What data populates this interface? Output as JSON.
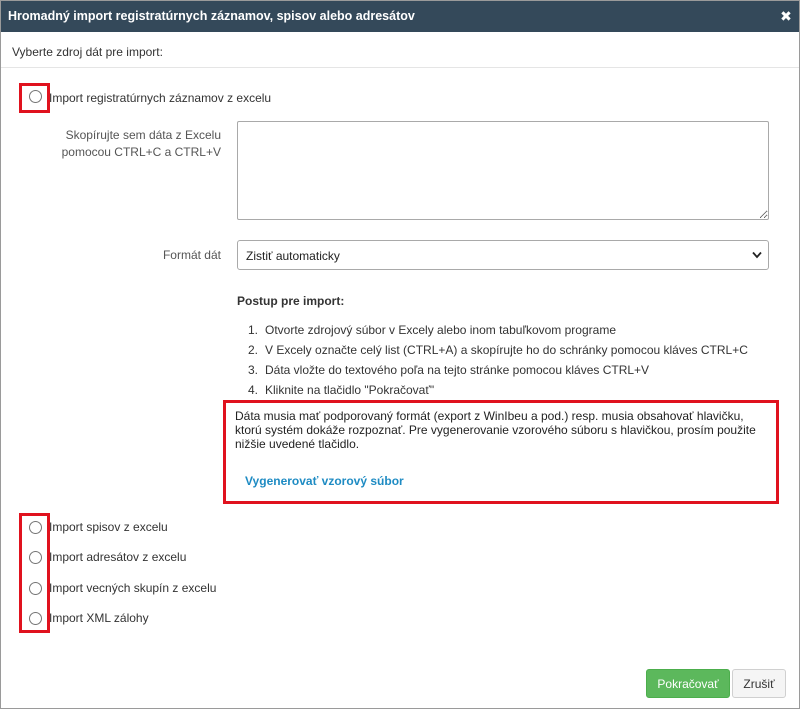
{
  "dialog": {
    "title": "Hromadný import registratúrnych záznamov, spisov alebo adresátov",
    "close_icon": "close-icon",
    "close_symbol": "✖",
    "subtitle": "Vyberte zdroj dát pre import:"
  },
  "options": [
    {
      "label": "Import registratúrnych záznamov z excelu",
      "selected": false
    },
    {
      "label": "Import spisov z excelu",
      "selected": false
    },
    {
      "label": "Import adresátov z excelu",
      "selected": false
    },
    {
      "label": "Import vecných skupín z excelu",
      "selected": false
    },
    {
      "label": "Import XML zálohy",
      "selected": false
    }
  ],
  "form": {
    "paste_label_line1": "Skopírujte sem dáta z Excelu",
    "paste_label_line2": "pomocou CTRL+C a CTRL+V",
    "paste_value": "",
    "format_label": "Formát dát",
    "format_selected": "Zistiť automaticky"
  },
  "instructions": {
    "title": "Postup pre import:",
    "steps": [
      {
        "num": "1.",
        "text": "Otvorte zdrojový súbor v Excely alebo inom tabuľkovom programe"
      },
      {
        "num": "2.",
        "text": "V Excely označte celý list (CTRL+A) a skopírujte ho do schránky pomocou kláves CTRL+C"
      },
      {
        "num": "3.",
        "text": "Dáta vložte do textového poľa na tejto stránke pomocou kláves CTRL+V"
      },
      {
        "num": "4.",
        "text": "Kliknite na tlačidlo \"Pokračovať\""
      }
    ]
  },
  "notice": {
    "text": "Dáta musia mať podporovaný formát (export z WinIbeu a pod.) resp. musia obsahovať hlavičku, ktorú systém dokáže rozpoznať. Pre vygenerovanie vzorového súboru s hlavičkou, prosím použite nižšie uvedené tlačidlo.",
    "link": "Vygenerovať vzorový súbor"
  },
  "footer": {
    "continue_label": "Pokračovať",
    "cancel_label": "Zrušiť"
  },
  "colors": {
    "titlebar": "#34495a",
    "highlight": "#e0121e",
    "primary_button": "#5cb85c",
    "link": "#1e8bc3"
  }
}
